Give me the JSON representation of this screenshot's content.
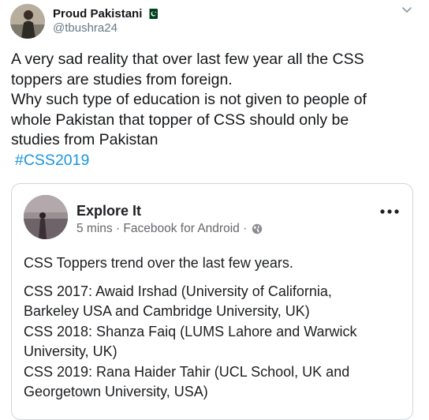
{
  "author": {
    "display_name": "Proud Pakistani",
    "flag_icon": "pakistan-flag-icon",
    "handle": "@tbushra24"
  },
  "tweet": {
    "lines": [
      "A very sad reality that over last few year all the CSS",
      "toppers are studies from foreign.",
      "Why such type of education is not given to people of",
      "whole Pakistan that topper of CSS should only be",
      "studies from Pakistan"
    ],
    "hashtag": "#CSS2019"
  },
  "embedded_post": {
    "page_name": "Explore It",
    "meta": "5 mins · Facebook for Android ·",
    "privacy_icon": "globe-icon",
    "intro": "CSS Toppers trend over the last few years.",
    "entries": [
      "CSS 2017: Awaid Irshad (University of California,",
      "Barkeley USA and Cambridge University, UK)",
      "CSS 2018: Shanza Faiq (LUMS Lahore and Warwick",
      "University, UK)",
      "CSS 2019: Rana Haider Tahir (UCL School, UK and",
      "Georgetown University, USA)"
    ]
  },
  "colors": {
    "link": "#1b95e0",
    "secondary_text": "#657786",
    "border": "#ccd6dd"
  }
}
